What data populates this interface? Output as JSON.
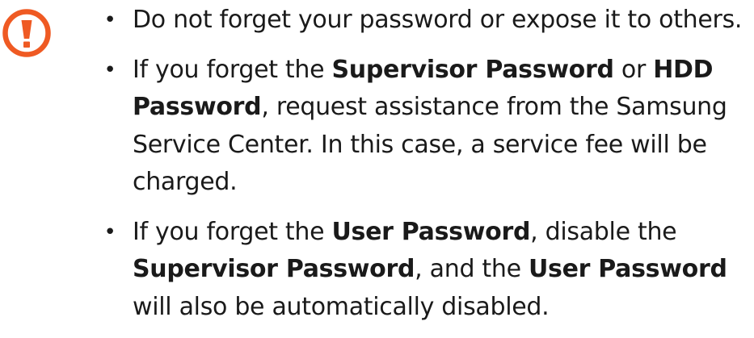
{
  "colors": {
    "caution_icon": "#ef5a23",
    "text": "#1a1a1a"
  },
  "icon": {
    "name": "caution-exclamation-icon"
  },
  "bullet_glyph": "•",
  "notes": [
    {
      "t1": "Do not forget your password or expose it to others."
    },
    {
      "t1": "If you forget the ",
      "b1": "Supervisor Password",
      "t2": " or ",
      "b2": "HDD Password",
      "t3": ", request assistance from the Samsung Service Center. In this case, a service fee will be charged."
    },
    {
      "t1": "If you forget the ",
      "b1": "User Password",
      "t2": ", disable the ",
      "b2": "Supervisor Password",
      "t3": ", and the ",
      "b3": "User Password",
      "t4": " will also be automatically disabled."
    }
  ]
}
